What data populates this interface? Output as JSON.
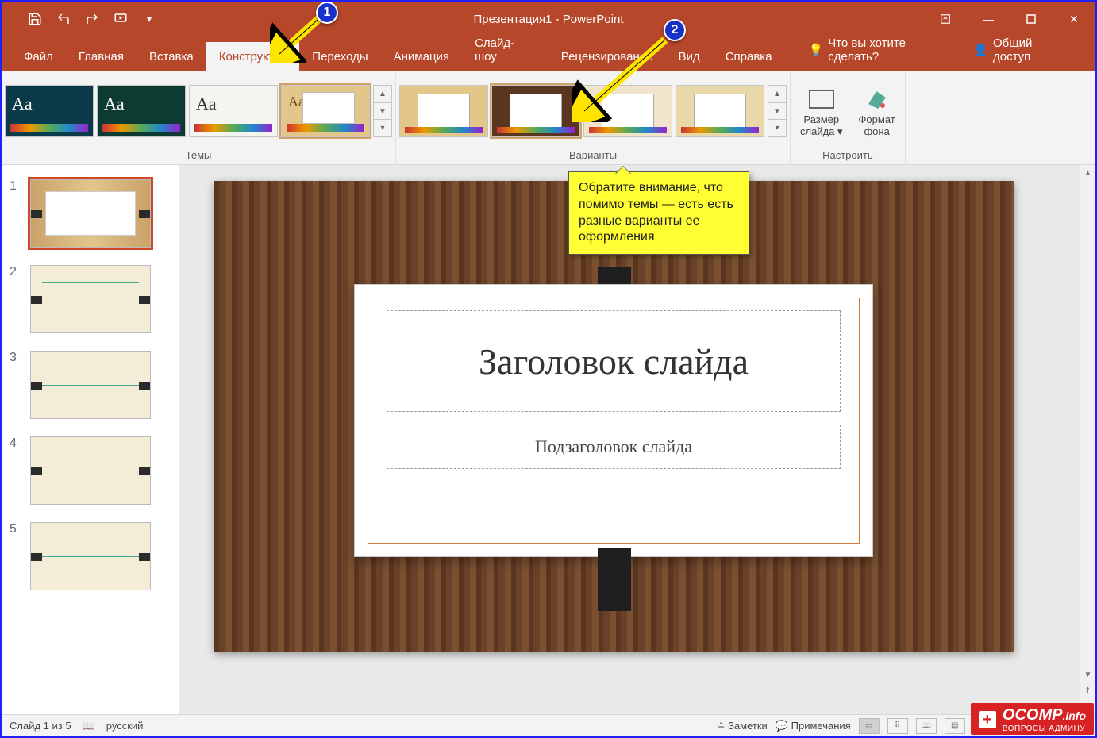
{
  "title": "Презентация1 - PowerPoint",
  "qat": {
    "save": "save-icon",
    "undo": "undo-icon",
    "redo": "redo-icon",
    "start": "start-from-beginning-icon"
  },
  "tabs": {
    "file": "Файл",
    "home": "Главная",
    "insert": "Вставка",
    "design": "Конструктор",
    "transitions": "Переходы",
    "animations": "Анимация",
    "slideshow": "Слайд-шоу",
    "review": "Рецензирование",
    "view": "Вид",
    "help": "Справка",
    "search": "Что вы хотите сделать?",
    "share": "Общий доступ"
  },
  "ribbon": {
    "themes_label": "Темы",
    "variants_label": "Варианты",
    "configure_label": "Настроить",
    "slide_size_top": "Размер",
    "slide_size_bottom": "слайда",
    "bg_format_top": "Формат",
    "bg_format_bottom": "фона"
  },
  "slides": {
    "count": 5,
    "numbers": [
      "1",
      "2",
      "3",
      "4",
      "5"
    ]
  },
  "canvas": {
    "title_placeholder": "Заголовок слайда",
    "subtitle_placeholder": "Подзаголовок слайда"
  },
  "status": {
    "slide_of": "Слайд 1 из 5",
    "language": "русский",
    "notes": "Заметки",
    "comments": "Примечания"
  },
  "annotations": {
    "badge1": "1",
    "badge2": "2",
    "tooltip": "Обратите внимание, что помимо темы — есть есть разные варианты ее оформления"
  },
  "watermark": {
    "brand": "OCOMP",
    "tld": ".info",
    "subtitle": "ВОПРОСЫ АДМИНУ"
  }
}
